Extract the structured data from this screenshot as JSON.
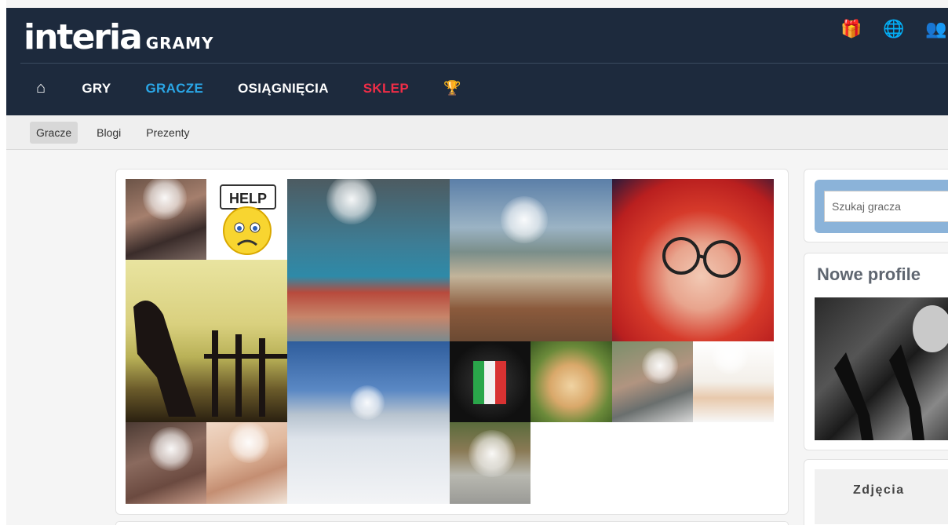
{
  "brand": {
    "logo_main": "interia",
    "logo_sub": "GRAMY"
  },
  "top_icons": [
    {
      "name": "gift-icon",
      "glyph": "🎁"
    },
    {
      "name": "globe-icon",
      "glyph": "🌐"
    },
    {
      "name": "users-icon",
      "glyph": "👥"
    }
  ],
  "nav": {
    "home_glyph": "⌂",
    "items": [
      "GRY",
      "GRACZE",
      "OSIĄGNIĘCIA",
      "SKLEP"
    ],
    "trophy_glyph": "🏆",
    "active_color": "#2aa6e6",
    "shop_color": "#f02d47"
  },
  "subnav": {
    "items": [
      "Gracze",
      "Blogi",
      "Prezenty"
    ]
  },
  "search": {
    "placeholder": "Szukaj gracza"
  },
  "profiles": {
    "title": "Nowe profile"
  },
  "photos": {
    "label": "Zdjęcia"
  },
  "colors": {
    "header_bg": "#1d2a3d",
    "search_panel": "#8bb3d9"
  }
}
